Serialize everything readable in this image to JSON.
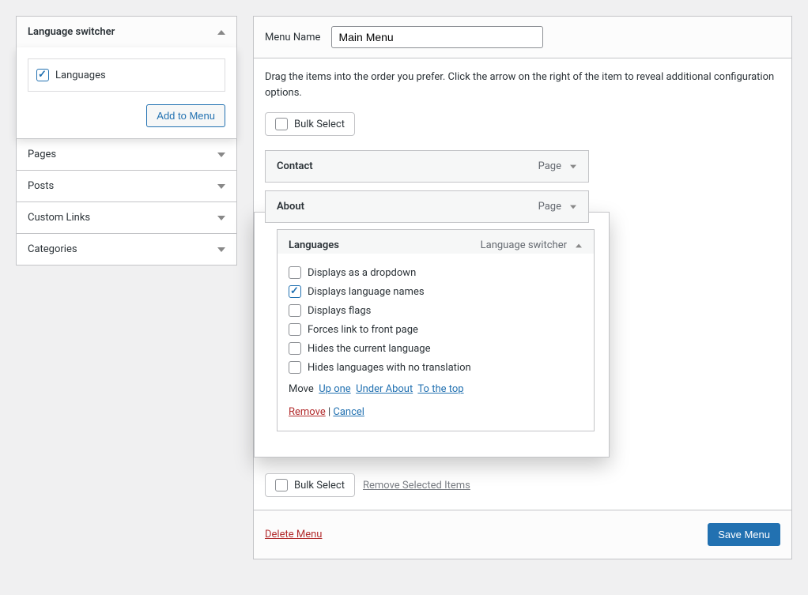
{
  "sidebar": {
    "sections": [
      {
        "label": "Language switcher",
        "open": true
      },
      {
        "label": "Pages"
      },
      {
        "label": "Posts"
      },
      {
        "label": "Custom Links"
      },
      {
        "label": "Categories"
      }
    ],
    "switcher_panel": {
      "item_label": "Languages",
      "add_button": "Add to Menu"
    }
  },
  "menu": {
    "name_label": "Menu Name",
    "name_value": "Main Menu",
    "help_text": "Drag the items into the order you prefer. Click the arrow on the right of the item to reveal additional configuration options.",
    "bulk_select": "Bulk Select",
    "remove_selected": "Remove Selected Items",
    "items": [
      {
        "title": "Contact",
        "type": "Page"
      },
      {
        "title": "About",
        "type": "Page"
      }
    ],
    "languages_item": {
      "title": "Languages",
      "type": "Language switcher",
      "options": [
        {
          "label": "Displays as a dropdown",
          "checked": false
        },
        {
          "label": "Displays language names",
          "checked": true
        },
        {
          "label": "Displays flags",
          "checked": false
        },
        {
          "label": "Forces link to front page",
          "checked": false
        },
        {
          "label": "Hides the current language",
          "checked": false
        },
        {
          "label": "Hides languages with no translation",
          "checked": false
        }
      ],
      "move_label": "Move",
      "move_links": [
        "Up one",
        "Under About",
        "To the top"
      ],
      "remove_label": "Remove",
      "cancel_label": "Cancel"
    },
    "delete_menu": "Delete Menu",
    "save_menu": "Save Menu"
  }
}
